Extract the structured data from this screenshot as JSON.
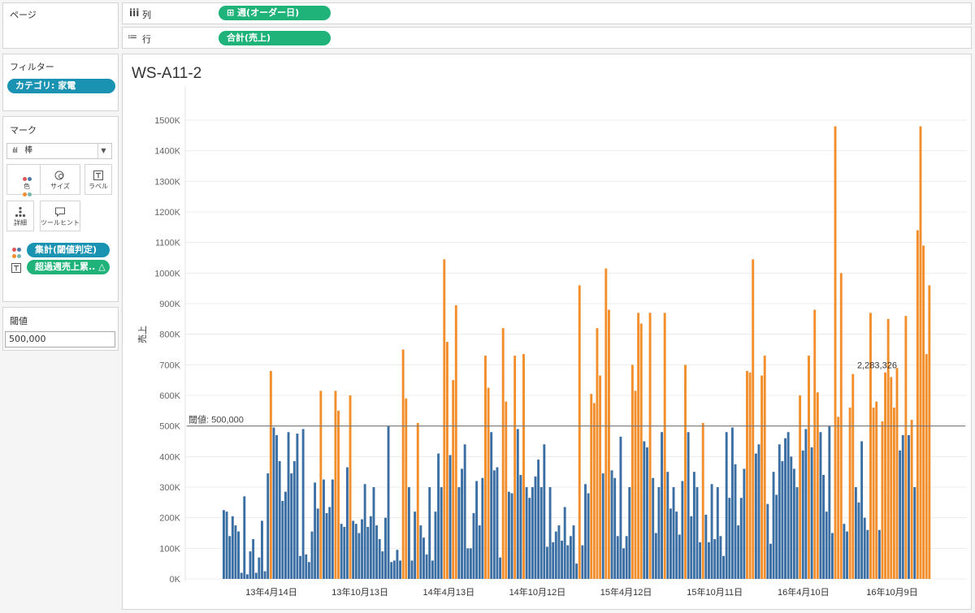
{
  "pages": {
    "title": "ページ"
  },
  "columns_shelf": {
    "icon": "iii",
    "label": "列",
    "pill": "週(オーダー日)",
    "pill_icon": "⊞"
  },
  "rows_shelf": {
    "icon": "≔",
    "label": "行",
    "pill": "合計(売上)"
  },
  "filters": {
    "title": "フィルター",
    "pill": "カテゴリ: 家電"
  },
  "marks": {
    "title": "マーク",
    "type_label": "棒",
    "cards": [
      {
        "label": "色",
        "icon": "color-icon"
      },
      {
        "label": "サイズ",
        "icon": "size-icon"
      },
      {
        "label": "ラベル",
        "icon": "label-icon"
      },
      {
        "label": "詳細",
        "icon": "detail-icon"
      },
      {
        "label": "ツールヒント",
        "icon": "tooltip-icon"
      }
    ],
    "pills": [
      {
        "text": "集計(閾値判定)",
        "icon": "color-icon"
      },
      {
        "text": "超過週売上累..  △",
        "icon": "label-icon"
      }
    ]
  },
  "threshold": {
    "title": "閾値",
    "value": "500,000"
  },
  "colors": {
    "below": "#3b6fa3",
    "above": "#f28e2b",
    "green_pill": "#1fb37a",
    "teal_pill": "#1a93b3"
  },
  "chart_data": {
    "type": "bar",
    "title": "WS-A11-2",
    "xlabel": "",
    "ylabel": "売上",
    "ylim": [
      0,
      1500000
    ],
    "y_ticks": [
      "0K",
      "100K",
      "200K",
      "300K",
      "400K",
      "500K",
      "600K",
      "700K",
      "800K",
      "900K",
      "1000K",
      "1100K",
      "1200K",
      "1300K",
      "1400K",
      "1500K"
    ],
    "x_tick_labels": [
      "13年4月14日",
      "13年10月13日",
      "14年4月13日",
      "14年10月12日",
      "15年4月12日",
      "15年10月11日",
      "16年4月10日",
      "16年10月9日"
    ],
    "reference_line": {
      "value": 500000,
      "label": "閾値: 500,000"
    },
    "annotation": "2,283,326",
    "series_colors": {
      "under": "#3b6fa3",
      "over": "#f28e2b"
    },
    "values": [
      225000,
      220000,
      140000,
      205000,
      175000,
      155000,
      20000,
      270000,
      15000,
      90000,
      130000,
      20000,
      70000,
      190000,
      25000,
      345000,
      680000,
      495000,
      470000,
      385000,
      255000,
      285000,
      480000,
      345000,
      385000,
      475000,
      75000,
      490000,
      80000,
      55000,
      155000,
      315000,
      230000,
      615000,
      325000,
      215000,
      235000,
      325000,
      615000,
      550000,
      180000,
      170000,
      365000,
      600000,
      190000,
      180000,
      150000,
      195000,
      310000,
      170000,
      205000,
      300000,
      175000,
      130000,
      90000,
      200000,
      500000,
      55000,
      60000,
      95000,
      60000,
      750000,
      590000,
      300000,
      60000,
      220000,
      510000,
      175000,
      135000,
      80000,
      300000,
      60000,
      220000,
      410000,
      300000,
      1045000,
      775000,
      405000,
      650000,
      895000,
      300000,
      360000,
      440000,
      100000,
      100000,
      215000,
      320000,
      175000,
      330000,
      730000,
      625000,
      480000,
      355000,
      365000,
      70000,
      820000,
      580000,
      285000,
      280000,
      730000,
      490000,
      340000,
      735000,
      300000,
      265000,
      300000,
      335000,
      390000,
      300000,
      440000,
      105000,
      300000,
      120000,
      155000,
      175000,
      125000,
      235000,
      110000,
      140000,
      175000,
      50000,
      960000,
      110000,
      310000,
      280000,
      605000,
      575000,
      820000,
      665000,
      345000,
      1015000,
      880000,
      355000,
      330000,
      140000,
      465000,
      100000,
      140000,
      300000,
      700000,
      615000,
      870000,
      835000,
      450000,
      430000,
      870000,
      330000,
      150000,
      300000,
      480000,
      870000,
      350000,
      230000,
      300000,
      220000,
      145000,
      320000,
      700000,
      480000,
      205000,
      350000,
      300000,
      120000,
      510000,
      210000,
      120000,
      310000,
      130000,
      300000,
      140000,
      75000,
      480000,
      265000,
      495000,
      375000,
      175000,
      265000,
      360000,
      680000,
      675000,
      1045000,
      410000,
      440000,
      665000,
      730000,
      245000,
      115000,
      350000,
      275000,
      440000,
      385000,
      460000,
      480000,
      400000,
      360000,
      300000,
      600000,
      420000,
      490000,
      730000,
      430000,
      880000,
      610000,
      480000,
      340000,
      220000,
      500000,
      150000,
      1480000,
      530000,
      1000000,
      180000,
      155000,
      560000,
      670000,
      300000,
      250000,
      450000,
      200000,
      160000,
      870000,
      560000,
      580000,
      160000,
      515000,
      675000,
      850000,
      660000,
      560000,
      690000,
      420000,
      470000,
      860000,
      470000,
      520000,
      300000,
      1140000,
      1480000,
      1090000,
      735000,
      960000
    ]
  }
}
